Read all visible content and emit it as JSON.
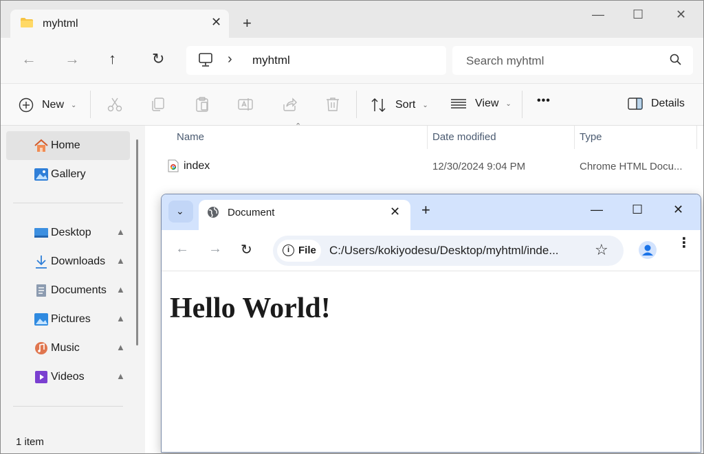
{
  "explorer": {
    "tab_title": "myhtml",
    "tab_close": "✕",
    "new_tab": "+",
    "window_controls": {
      "minimize": "—",
      "maximize": "☐",
      "close": "✕"
    },
    "nav": {
      "back": "←",
      "forward": "→",
      "up": "↑",
      "refresh": "↻"
    },
    "address": {
      "chevron": "›",
      "crumb": "myhtml"
    },
    "search": {
      "placeholder": "Search myhtml"
    },
    "toolbar": {
      "new_label": "New",
      "sort_label": "Sort",
      "view_label": "View",
      "more_label": "•••",
      "details_label": "Details"
    },
    "sidebar": {
      "items": [
        {
          "label": "Home",
          "icon": "home-icon"
        },
        {
          "label": "Gallery",
          "icon": "gallery-icon"
        },
        {
          "label": "Desktop",
          "icon": "desktop-icon",
          "pinned": true
        },
        {
          "label": "Downloads",
          "icon": "downloads-icon",
          "pinned": true
        },
        {
          "label": "Documents",
          "icon": "documents-icon",
          "pinned": true
        },
        {
          "label": "Pictures",
          "icon": "pictures-icon",
          "pinned": true
        },
        {
          "label": "Music",
          "icon": "music-icon",
          "pinned": true
        },
        {
          "label": "Videos",
          "icon": "videos-icon",
          "pinned": true
        }
      ],
      "pin_glyph": "📌"
    },
    "columns": {
      "name": "Name",
      "date": "Date modified",
      "type": "Type"
    },
    "files": [
      {
        "name": "index",
        "date": "12/30/2024 9:04 PM",
        "type": "Chrome HTML Docu..."
      }
    ],
    "status": "1 item",
    "colors": {
      "accent": "#0067c0",
      "folder": "#f6c445"
    }
  },
  "chrome": {
    "tab_search": "⌄",
    "tab_title": "Document",
    "tab_close": "✕",
    "new_tab": "+",
    "window_controls": {
      "minimize": "—",
      "maximize": "☐",
      "close": "✕"
    },
    "nav": {
      "back": "←",
      "forward": "→",
      "reload": "↻"
    },
    "omnibox": {
      "info": "i",
      "scheme": "File",
      "url": "C:/Users/kokiyodesu/Desktop/myhtml/inde...",
      "star": "☆"
    },
    "menu": "⋮",
    "page": {
      "heading": "Hello World!"
    },
    "colors": {
      "tabstrip": "#d3e3fd",
      "omnibox": "#eef2f9"
    }
  }
}
